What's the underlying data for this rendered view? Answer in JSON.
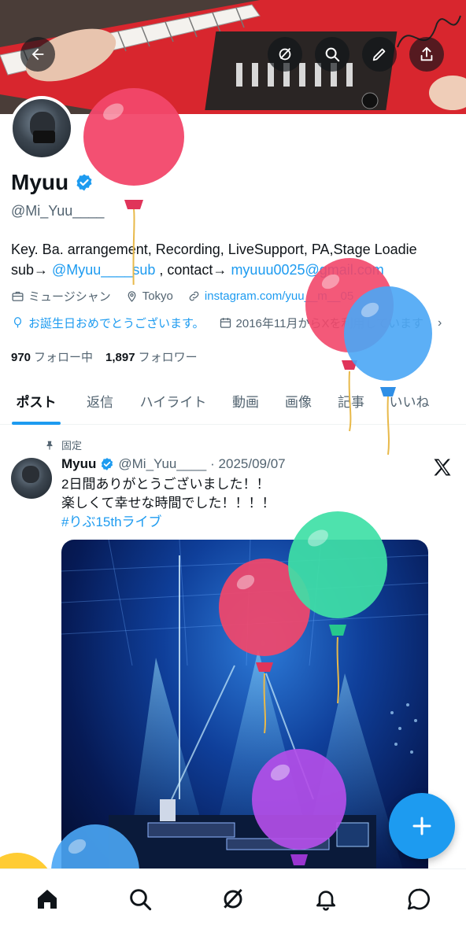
{
  "header": {
    "back_icon": "back-arrow-icon",
    "actions": [
      "grok-icon",
      "search-icon",
      "edit-icon",
      "share-icon"
    ]
  },
  "profile": {
    "name": "Myuu",
    "handle": "@Mi_Yuu____",
    "bio_line1": "Key. Ba. arrangement, Recording, LiveSupport, PA,Stage Loadie",
    "bio_sub_prefix": "sub→ ",
    "bio_sub_link": "@Myuu____sub",
    "bio_contact_prefix": " , contact→ ",
    "bio_contact_link": "myuuu0025@gmail.com",
    "category": "ミュージシャン",
    "location": "Tokyo",
    "website": "instagram.com/yuu__m__05",
    "birthday": "お誕生日おめでとうございます。",
    "joined": "2016年11月からXを利用しています",
    "following_count": "970",
    "following_label": "フォロー中",
    "followers_count": "1,897",
    "followers_label": "フォロワー"
  },
  "tabs": [
    {
      "label": "ポスト",
      "active": true
    },
    {
      "label": "返信"
    },
    {
      "label": "ハイライト"
    },
    {
      "label": "動画"
    },
    {
      "label": "画像"
    },
    {
      "label": "記事"
    },
    {
      "label": "いいね"
    }
  ],
  "post": {
    "pinned_label": "固定",
    "author": "Myuu",
    "handle": "@Mi_Yuu____",
    "date": "· 2025/09/07",
    "line1": "2日間ありがとうございました！！",
    "line2": "楽しくて幸せな時間でした！！！！",
    "hashtag": "#りぶ15thライブ"
  },
  "bottom_nav": [
    "home-icon",
    "search-icon",
    "grok-icon",
    "notifications-icon",
    "messages-icon"
  ],
  "colors": {
    "accent": "#1d9bf0",
    "text": "#0f1419",
    "secondary": "#536471"
  }
}
